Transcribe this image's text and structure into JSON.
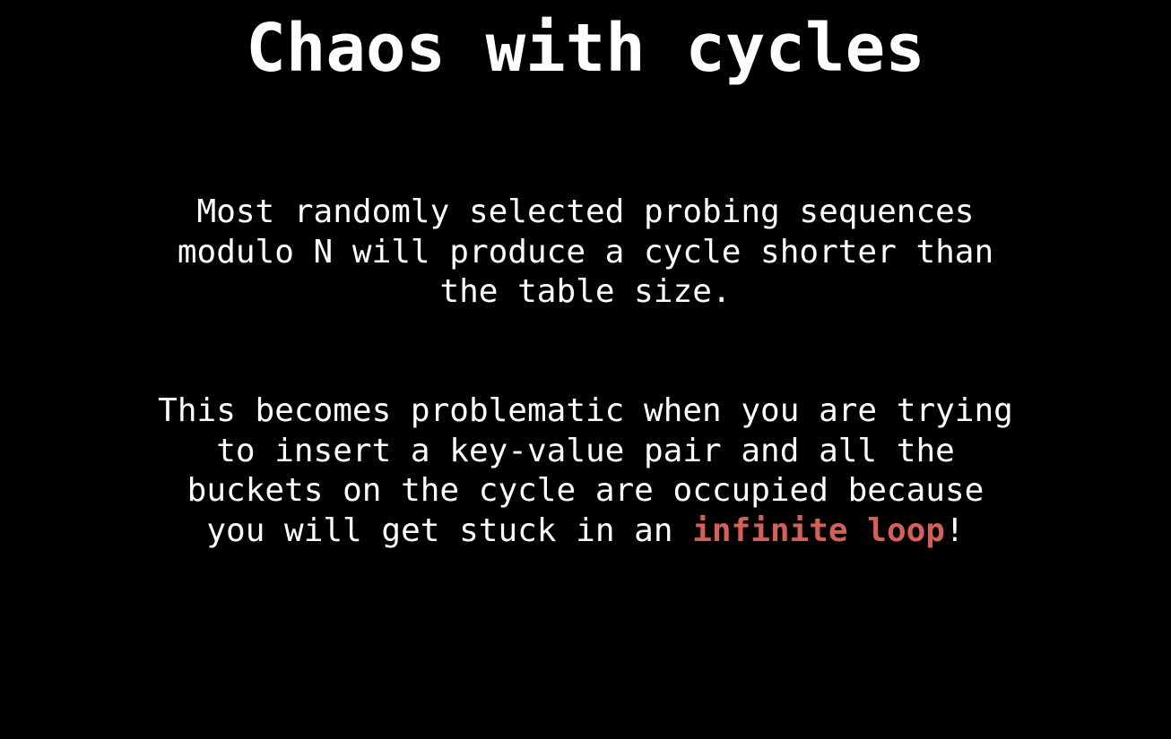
{
  "slide": {
    "title": "Chaos with cycles",
    "paragraph1": {
      "lines": [
        "Most randomly selected probing sequences",
        "modulo N will produce a cycle shorter than",
        "the table size."
      ]
    },
    "paragraph2": {
      "lines": [
        "This becomes problematic when you are trying",
        "to insert a key-value pair and all the",
        "buckets on the cycle are occupied because"
      ],
      "last_line_prefix": "you will get stuck in an ",
      "highlight": "infinite loop",
      "last_line_suffix": "!"
    },
    "colors": {
      "background": "#000000",
      "text": "#ffffff",
      "highlight": "#d4605a"
    }
  }
}
